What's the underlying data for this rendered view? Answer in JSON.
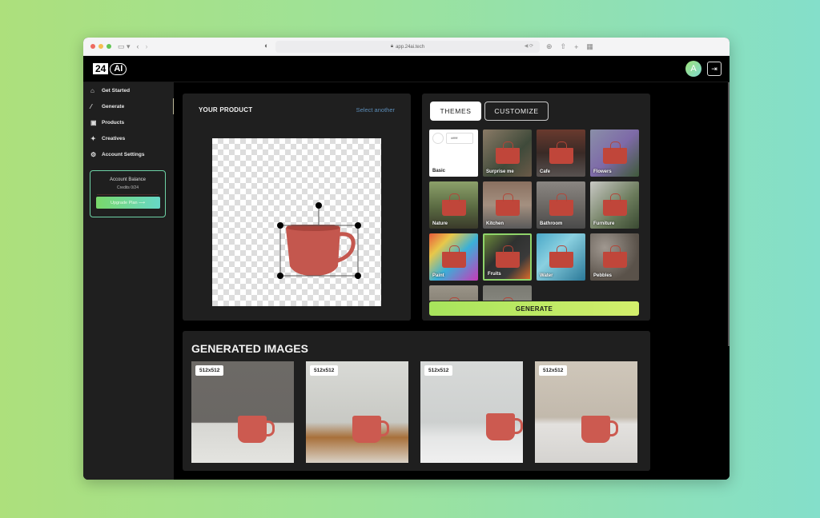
{
  "browser": {
    "url": "app.24ai.tech",
    "traffic_lights": [
      "#ee6a5f",
      "#f5be4f",
      "#62c554"
    ]
  },
  "header": {
    "logo_part1": "24",
    "logo_part2": "AI",
    "avatar_initial": "A",
    "logout_icon": "logout-icon"
  },
  "sidebar": {
    "items": [
      {
        "label": "Get Started",
        "icon": "home-icon",
        "glyph": "⌂"
      },
      {
        "label": "Generate",
        "icon": "magic-wand-icon",
        "glyph": "⁄"
      },
      {
        "label": "Products",
        "icon": "briefcase-icon",
        "glyph": "▣"
      },
      {
        "label": "Creatives",
        "icon": "sparkles-icon",
        "glyph": "✦"
      },
      {
        "label": "Account Settings",
        "icon": "gear-icon",
        "glyph": "⚙"
      }
    ],
    "balance": {
      "title": "Account Balance",
      "credits": "Credits 0/24",
      "upgrade_label": "Upgrade Plan ⟶"
    }
  },
  "product_panel": {
    "title": "YOUR PRODUCT",
    "select_another": "Select another"
  },
  "themes_panel": {
    "tabs": [
      {
        "label": "THEMES",
        "active": true
      },
      {
        "label": "CUSTOMIZE",
        "active": false
      }
    ],
    "basic_swatch_text": "#ffffff",
    "themes": [
      {
        "label": "Basic",
        "bg": "#ffffff"
      },
      {
        "label": "Surprise me",
        "bg": "linear-gradient(135deg,#8a7a66,#3f4a3a 60%,#6b5a48)"
      },
      {
        "label": "Cafe",
        "bg": "linear-gradient(180deg,#6a3a2e,#3a2a26 50%,#585250)"
      },
      {
        "label": "Flowers",
        "bg": "linear-gradient(135deg,#8a8fa8,#7e6aa8 50%,#3f5a3a)"
      },
      {
        "label": "Nature",
        "bg": "linear-gradient(180deg,#8ca06a,#5a6a42 55%,#3a3a2a)"
      },
      {
        "label": "Kitchen",
        "bg": "linear-gradient(180deg,#8a7060,#a49080 50%,#5a5a5a)"
      },
      {
        "label": "Bathroom",
        "bg": "linear-gradient(180deg,#8a8682,#6a6662 55%,#4a4a4a)"
      },
      {
        "label": "Furniture",
        "bg": "linear-gradient(135deg,#c8c8c4,#6a7a5a 60%,#3a4a32)"
      },
      {
        "label": "Paint",
        "bg": "linear-gradient(135deg,#e85a3a,#e8c84a 25%,#3ab0d8 55%,#c83ab8)"
      },
      {
        "label": "Fruits",
        "bg": "linear-gradient(135deg,#6a8a3a,#2f3130 40%,#3a3a3a 70%,#d86a2a)",
        "selected": true
      },
      {
        "label": "Water",
        "bg": "linear-gradient(135deg,#4aa8c8,#8ad0e0 40%,#2a7898)"
      },
      {
        "label": "Pebbles",
        "bg": "radial-gradient(circle at 30% 30%,#a09890,#5a524a 70%)"
      },
      {
        "label": "",
        "bg": "linear-gradient(180deg,#9a9488,#6a6458)"
      },
      {
        "label": "",
        "bg": "linear-gradient(180deg,#7a7a72,#9a9a92)"
      }
    ],
    "generate_label": "GENERATE"
  },
  "generated": {
    "title": "GENERATED IMAGES",
    "images": [
      {
        "size": "512x512",
        "bg": "linear-gradient(180deg,#6d6a66 0%,#6a6764 60%,#d6d6d2 61%,#e4e4e0 100%)"
      },
      {
        "size": "512x512",
        "bg": "linear-gradient(180deg,#d9dad6 0%,#c8c9c4 60%,#a8703a 75%,#d9d2c6 100%)"
      },
      {
        "size": "512x512",
        "bg": "linear-gradient(180deg,#d7d9d8 0%,#cdd0cf 60%,#e5e6e6 75%,#f0f0f0 100%)"
      },
      {
        "size": "512x512",
        "bg": "linear-gradient(180deg,#cfc7ba 0%,#c2b9ac 55%,#e3e1de 62%,#d5d3d0 100%)"
      }
    ]
  },
  "colors": {
    "accent_green": "#a7e45c",
    "link_blue": "#5a8bb6",
    "panel_bg": "#1f1f1f"
  }
}
